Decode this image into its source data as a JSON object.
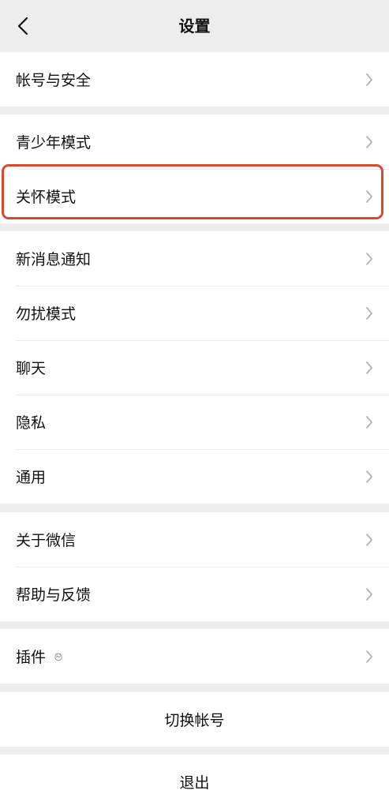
{
  "nav": {
    "title": "设置",
    "back_icon": "chevron-left-icon"
  },
  "groups": [
    {
      "items": [
        {
          "label": "帐号与安全"
        }
      ]
    },
    {
      "items": [
        {
          "label": "青少年模式"
        },
        {
          "label": "关怀模式",
          "highlighted": true
        }
      ]
    },
    {
      "items": [
        {
          "label": "新消息通知"
        },
        {
          "label": "勿扰模式"
        },
        {
          "label": "聊天"
        },
        {
          "label": "隐私"
        },
        {
          "label": "通用"
        }
      ]
    },
    {
      "items": [
        {
          "label": "关于微信"
        },
        {
          "label": "帮助与反馈"
        }
      ]
    },
    {
      "items": [
        {
          "label": "插件",
          "icon": "plugin-icon"
        }
      ]
    }
  ],
  "actions": {
    "switch_account": "切换帐号",
    "logout": "退出"
  },
  "colors": {
    "background": "#ededed",
    "highlight_border": "#d8492f",
    "chevron": "#b3b3b3"
  },
  "icons": {
    "row_chevron": "chevron-right-icon"
  }
}
